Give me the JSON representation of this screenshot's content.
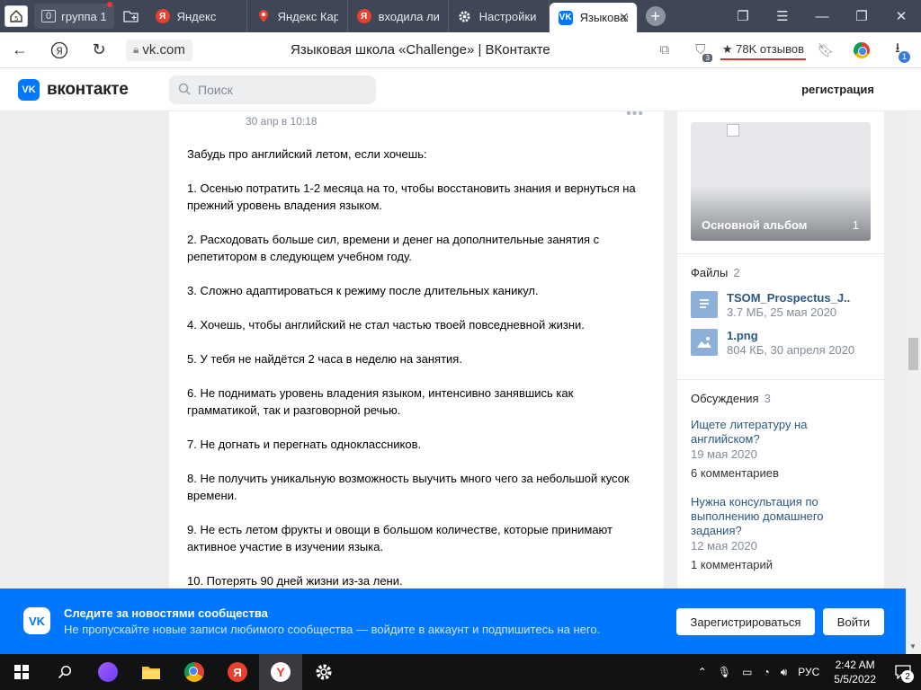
{
  "browser": {
    "tab_group": {
      "count": "0",
      "label": "группа 1"
    },
    "tabs": [
      {
        "label": "Яндекс",
        "icon": "yandex-icon",
        "color": "#e9402f"
      },
      {
        "label": "Яндекс Карты",
        "icon": "map-pin-icon",
        "color": "#e9402f"
      },
      {
        "label": "входила ли",
        "icon": "yandex-icon",
        "color": "#e9402f"
      },
      {
        "label": "Настройки",
        "icon": "gear-icon",
        "color": "#ffffff"
      },
      {
        "label": "Языковая школа",
        "icon": "vk-icon",
        "color": "#0077ff",
        "active": true
      }
    ],
    "url": "vk.com",
    "page_title": "Языковая школа «Challenge» | ВКонтакте",
    "reviews": "★ 78K отзывов",
    "extension_badge": "3",
    "download_badge": "1"
  },
  "vk": {
    "logo": "вконтакте",
    "search_placeholder": "Поиск",
    "register_link": "регистрация"
  },
  "post": {
    "date": "30 апр в 10:18",
    "paragraphs": [
      "Забудь про английский летом, если хочешь:",
      "1. Осенью потратить 1-2 месяца на то, чтобы восстановить знания и вернуться на прежний уровень владения языком.",
      "2. Расходовать больше сил, времени и денег на дополнительные занятия с репетитором в следующем учебном году.",
      "3. Сложно адаптироваться к режиму после длительных каникул.",
      "4. Хочешь, чтобы английский не стал частью твоей повседневной жизни.",
      "5. У тебя не найдётся 2 часа в неделю на занятия.",
      "6. Не поднимать уровень владения языком, интенсивно занявшись как грамматикой, так и разговорной речью.",
      "7. Не догнать и перегнать одноклассников.",
      "8. Не получить уникальную возможность выучить много чего за небольшой кусок времени.",
      "9. Не есть летом фрукты и овощи в большом количестве, которые принимают активное участие в изучении языка.",
      "10. Потерять 90 дней жизни из-за лени."
    ]
  },
  "sidebar": {
    "album": {
      "name": "Основной альбом",
      "count": "1"
    },
    "files": {
      "title": "Файлы",
      "count": "2",
      "items": [
        {
          "name": "TSOM_Prospectus_J..",
          "meta": "3.7 МБ, 25 мая 2020",
          "icon": "document-icon"
        },
        {
          "name": "1.png",
          "meta": "804 КБ, 30 апреля 2020",
          "icon": "image-icon"
        }
      ]
    },
    "discussions": {
      "title": "Обсуждения",
      "count": "3",
      "items": [
        {
          "title": "Ищете литературу на английском?",
          "date": "19 мая 2020",
          "comments": "6 комментариев"
        },
        {
          "title": "Нужна консультация по выполнению домашнего задания?",
          "date": "12 мая 2020",
          "comments": "1 комментарий"
        }
      ]
    }
  },
  "banner": {
    "title": "Следите за новостями сообщества",
    "subtitle": "Не пропускайте новые записи любимого сообщества — войдите в аккаунт и подпишитесь на него.",
    "register_button": "Зарегистрироваться",
    "login_button": "Войти"
  },
  "taskbar": {
    "language": "РУС",
    "time": "2:42 AM",
    "date": "5/5/2022",
    "notifications": "2"
  },
  "colors": {
    "vk_blue": "#0077ff",
    "link": "#2a5885",
    "tabbar": "#3f4655"
  }
}
